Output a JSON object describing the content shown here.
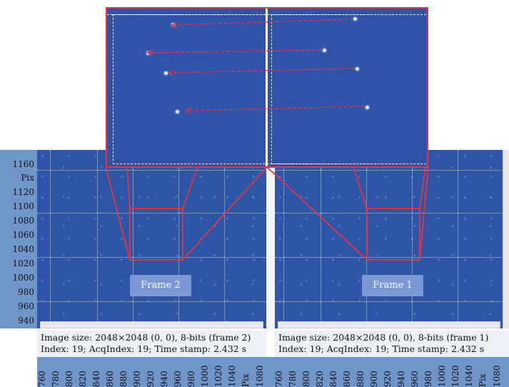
{
  "y_axis": {
    "ticks": [
      "1160",
      "Pix",
      "1120",
      "1100",
      "1080",
      "1060",
      "1040",
      "1020",
      "1000",
      "980",
      "960",
      "940"
    ]
  },
  "x_axis": {
    "left_ticks": [
      "760",
      "780",
      "800",
      "820",
      "840",
      "860",
      "880",
      "900",
      "920",
      "940",
      "960",
      "980",
      "1000",
      "1020",
      "1040",
      "Pix",
      "1080"
    ],
    "right_ticks": [
      "760",
      "780",
      "800",
      "820",
      "840",
      "860",
      "880",
      "900",
      "920",
      "940",
      "960",
      "980",
      "1000",
      "1020",
      "1040",
      "Pix",
      "1080"
    ]
  },
  "frames": [
    {
      "label": "Frame 2",
      "status_line1": "Image size: 2048×2048 (0, 0), 8-bits (frame 2)",
      "status_line2": "Index: 19; AcqIndex: 19; Time stamp: 2.432 s"
    },
    {
      "label": "Frame 1",
      "status_line1": "Image size: 2048×2048 (0, 0), 8-bits (frame 1)",
      "status_line2": "Index: 19; AcqIndex: 19; Time stamp: 2.432 s"
    }
  ],
  "colors": {
    "background_blue": "#2f55a9",
    "axis_panel": "#6f95c9",
    "highlight_red": "#e03840",
    "status_bg": "#eef0f7"
  }
}
